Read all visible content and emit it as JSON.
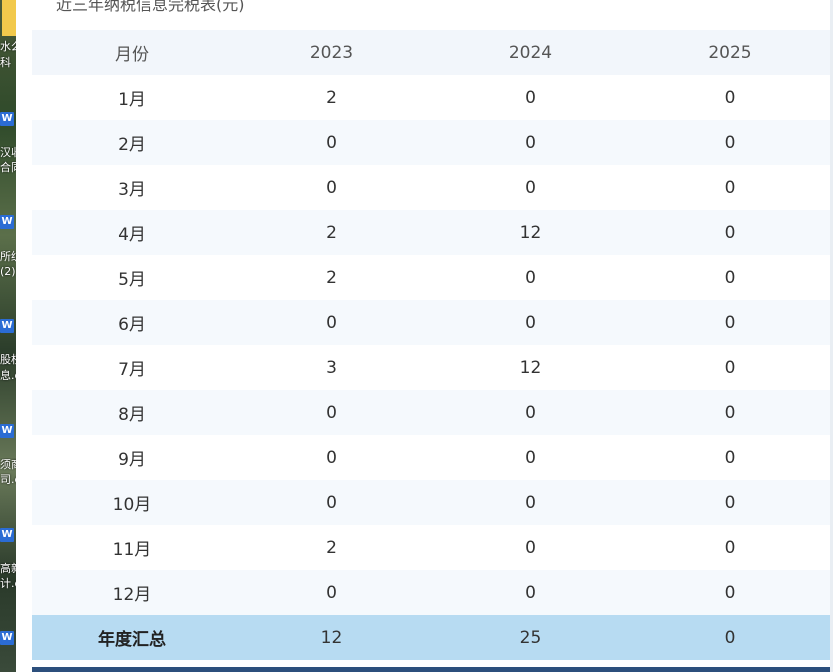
{
  "caption": "近三年纳税信息完税表(元)",
  "colors": {
    "header_bg": "#f2f6fb",
    "alt_row_bg": "#f5f9fd",
    "total_row_bg": "#b7dbf2",
    "bottom_bar": "#2c4f7c"
  },
  "desktop": {
    "fragments": [
      "水么",
      "科",
      "汉收",
      "合同",
      "所纺",
      "(2)",
      "股权",
      "息.d",
      "须商",
      "司.d",
      "高新",
      "计.d"
    ],
    "word_icon": "W"
  },
  "table": {
    "headers": [
      "月份",
      "2023",
      "2024",
      "2025"
    ],
    "rows": [
      {
        "month": "1月",
        "y2023": "2",
        "y2024": "0",
        "y2025": "0"
      },
      {
        "month": "2月",
        "y2023": "0",
        "y2024": "0",
        "y2025": "0"
      },
      {
        "month": "3月",
        "y2023": "0",
        "y2024": "0",
        "y2025": "0"
      },
      {
        "month": "4月",
        "y2023": "2",
        "y2024": "12",
        "y2025": "0"
      },
      {
        "month": "5月",
        "y2023": "2",
        "y2024": "0",
        "y2025": "0"
      },
      {
        "month": "6月",
        "y2023": "0",
        "y2024": "0",
        "y2025": "0"
      },
      {
        "month": "7月",
        "y2023": "3",
        "y2024": "12",
        "y2025": "0"
      },
      {
        "month": "8月",
        "y2023": "0",
        "y2024": "0",
        "y2025": "0"
      },
      {
        "month": "9月",
        "y2023": "0",
        "y2024": "0",
        "y2025": "0"
      },
      {
        "month": "10月",
        "y2023": "0",
        "y2024": "0",
        "y2025": "0"
      },
      {
        "month": "11月",
        "y2023": "2",
        "y2024": "0",
        "y2025": "0"
      },
      {
        "month": "12月",
        "y2023": "0",
        "y2024": "0",
        "y2025": "0"
      }
    ],
    "total": {
      "label": "年度汇总",
      "y2023": "12",
      "y2024": "25",
      "y2025": "0"
    }
  }
}
